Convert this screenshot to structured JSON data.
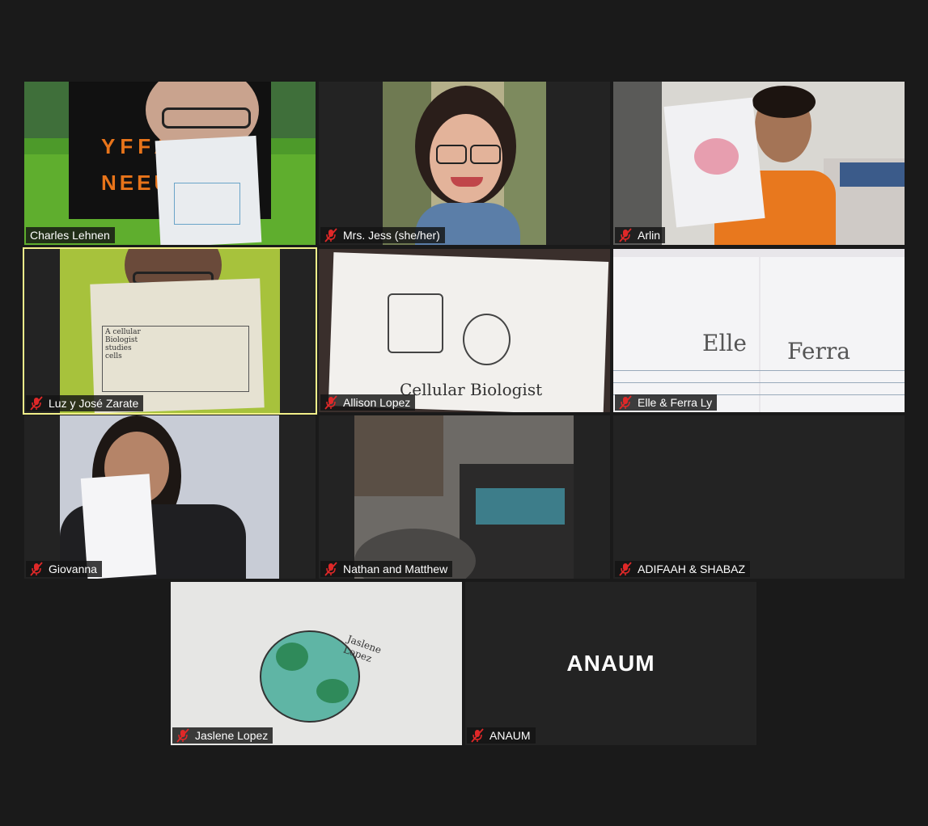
{
  "participants": [
    {
      "name": "Charles Lehnen",
      "muted": false,
      "active": false
    },
    {
      "name": "Mrs. Jess (she/her)",
      "muted": true,
      "active": false
    },
    {
      "name": "Arlin",
      "muted": true,
      "active": false
    },
    {
      "name": "Luz y José Zarate",
      "muted": true,
      "active": true
    },
    {
      "name": "Allison Lopez",
      "muted": true,
      "active": false
    },
    {
      "name": "Elle & Ferra Ly",
      "muted": true,
      "active": false
    },
    {
      "name": "Giovanna",
      "muted": true,
      "active": false
    },
    {
      "name": "Nathan and Matthew",
      "muted": true,
      "active": false
    },
    {
      "name": "ADIFAAH & SHABAZ",
      "muted": true,
      "active": false,
      "video_off": true
    },
    {
      "name": "Jaslene Lopez",
      "muted": true,
      "active": false
    },
    {
      "name": "ANAUM",
      "muted": true,
      "active": false,
      "video_off": true,
      "display_name": "ANAUM"
    }
  ],
  "colors": {
    "background": "#1a1a1a",
    "tile_background": "#232323",
    "active_border": "#f2f08a",
    "muted_icon": "#e02828"
  },
  "icons": {
    "muted": "mic-off-icon"
  }
}
